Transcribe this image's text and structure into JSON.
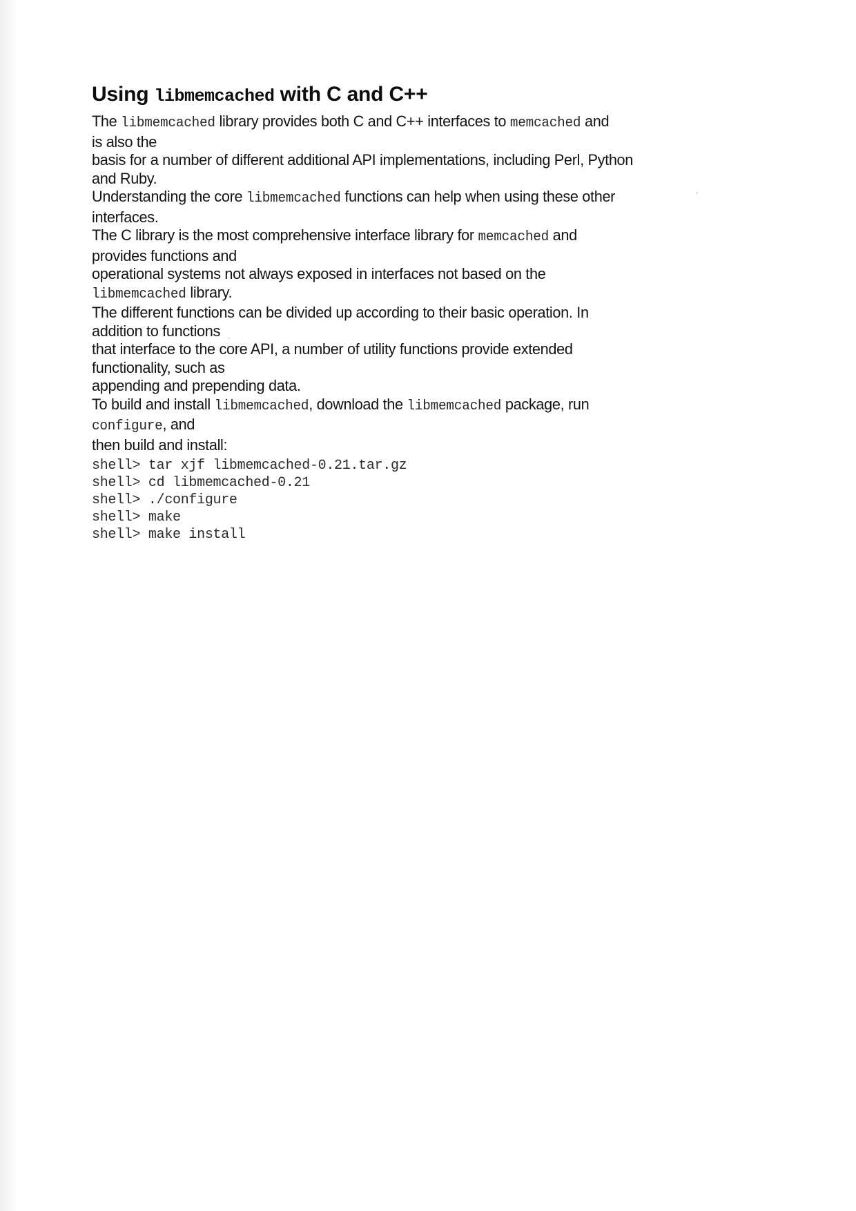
{
  "document": {
    "title_parts": [
      {
        "text": "Using ",
        "style": "bold"
      },
      {
        "text": "libmemcached",
        "style": "mono"
      },
      {
        "text": " with C and C++",
        "style": "bold"
      }
    ],
    "title_plain": "Using libmemcached with C and C++",
    "paragraph_lines": [
      {
        "id": "line-1",
        "plain": "The libmemcached library provides both C and C++ interfaces to memcached and",
        "runs": [
          {
            "text": "The ",
            "style": "normal"
          },
          {
            "text": "libmemcached",
            "style": "mono"
          },
          {
            "text": " library provides both C and C++ interfaces to ",
            "style": "normal"
          },
          {
            "text": "memcached",
            "style": "mono"
          },
          {
            "text": " and",
            "style": "normal"
          }
        ]
      },
      {
        "id": "line-2",
        "plain": "is also the",
        "runs": [
          {
            "text": "is also the",
            "style": "normal"
          }
        ]
      },
      {
        "id": "line-3",
        "plain": "basis for a number of different additional API implementations, including Perl, Python",
        "runs": [
          {
            "text": "basis for a number of different additional API implementations, including Perl, Python",
            "style": "normal"
          }
        ]
      },
      {
        "id": "line-4",
        "plain": "and Ruby.",
        "runs": [
          {
            "text": "and Ruby.",
            "style": "normal"
          }
        ]
      },
      {
        "id": "line-5",
        "plain": "Understanding the core libmemcached functions can help when using these other",
        "runs": [
          {
            "text": "Understanding the core ",
            "style": "normal"
          },
          {
            "text": "libmemcached",
            "style": "mono"
          },
          {
            "text": " functions can help when using these other",
            "style": "normal"
          }
        ]
      },
      {
        "id": "line-6",
        "plain": "interfaces.",
        "runs": [
          {
            "text": "interfaces.",
            "style": "normal"
          }
        ]
      },
      {
        "id": "line-7",
        "plain": "The C library is the most comprehensive interface library for memcached and",
        "runs": [
          {
            "text": "The C library is the most comprehensive interface library for ",
            "style": "normal"
          },
          {
            "text": "memcached",
            "style": "mono"
          },
          {
            "text": " and",
            "style": "normal"
          }
        ]
      },
      {
        "id": "line-8",
        "plain": "provides functions and",
        "runs": [
          {
            "text": "provides functions and",
            "style": "normal"
          }
        ]
      },
      {
        "id": "line-9",
        "plain": "operational systems not always exposed in interfaces not based on the",
        "runs": [
          {
            "text": "operational systems not always exposed in interfaces not based on the",
            "style": "normal"
          }
        ]
      },
      {
        "id": "line-10",
        "plain": "libmemcached library.",
        "runs": [
          {
            "text": "libmemcached",
            "style": "mono"
          },
          {
            "text": " library.",
            "style": "normal"
          }
        ]
      },
      {
        "id": "line-11",
        "plain": "The different functions can be divided up according to their basic operation. In",
        "runs": [
          {
            "text": "The different functions can be divided up according to their basic operation. In",
            "style": "normal"
          }
        ]
      },
      {
        "id": "line-12",
        "plain": "addition to functions",
        "runs": [
          {
            "text": "addition to functions",
            "style": "normal"
          }
        ]
      },
      {
        "id": "line-13",
        "plain": "that interface to the core API, a number of utility functions provide extended",
        "runs": [
          {
            "text": "that interface to the core API, a number of utility functions provide extended",
            "style": "normal"
          }
        ]
      },
      {
        "id": "line-14",
        "plain": "functionality, such as",
        "runs": [
          {
            "text": "functionality, such as",
            "style": "normal"
          }
        ]
      },
      {
        "id": "line-15",
        "plain": "appending and prepending data.",
        "runs": [
          {
            "text": "appending and prepending data.",
            "style": "normal"
          }
        ]
      },
      {
        "id": "line-16",
        "plain": "To build and install libmemcached, download the libmemcached package, run",
        "runs": [
          {
            "text": "To build and install ",
            "style": "normal"
          },
          {
            "text": "libmemcached",
            "style": "mono"
          },
          {
            "text": ", download the ",
            "style": "normal"
          },
          {
            "text": "libmemcached",
            "style": "mono"
          },
          {
            "text": " package, run",
            "style": "normal"
          }
        ]
      },
      {
        "id": "line-17",
        "plain": "configure, and",
        "runs": [
          {
            "text": "configure",
            "style": "mono"
          },
          {
            "text": ", and",
            "style": "normal"
          }
        ]
      },
      {
        "id": "line-18",
        "plain": "then build and install:",
        "runs": [
          {
            "text": "then build and install:",
            "style": "normal"
          }
        ]
      }
    ],
    "shell_commands": [
      "shell> tar xjf libmemcached-0.21.tar.gz",
      "shell> cd libmemcached-0.21",
      "shell> ./configure",
      "shell> make",
      "shell> make install"
    ]
  },
  "colors": {
    "page_background": "#fefefe",
    "body_text": "#141414",
    "heading_text": "#0d0d0d",
    "code_text": "#2b2b2b"
  }
}
